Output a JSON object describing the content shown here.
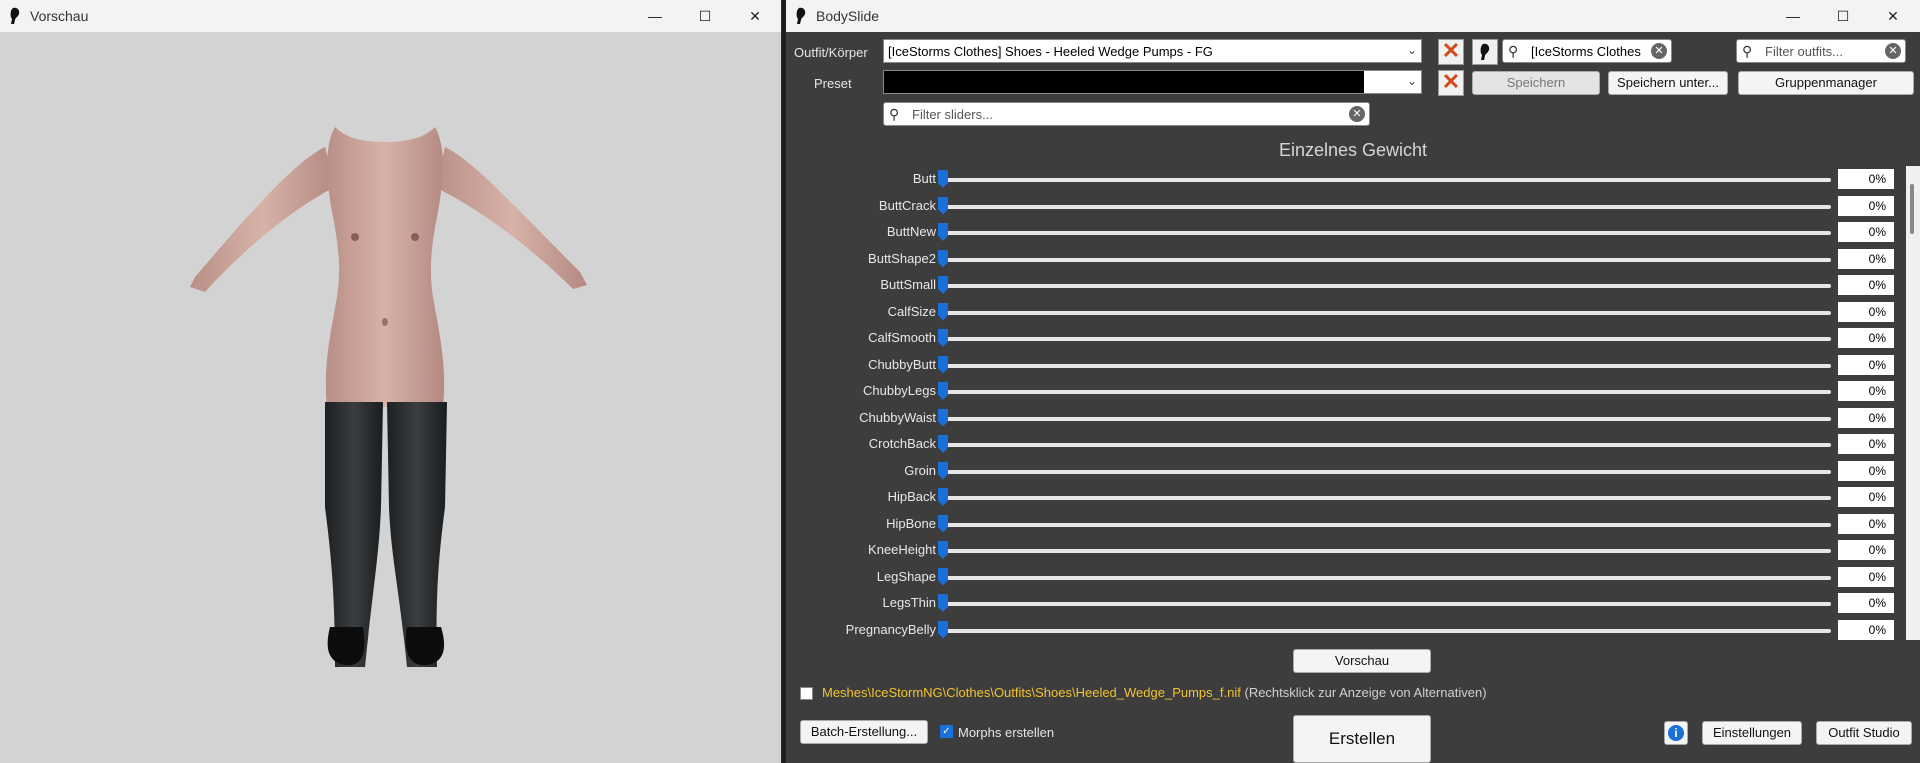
{
  "preview_window": {
    "title": "Vorschau",
    "controls": {
      "minimize": "—",
      "maximize": "☐",
      "close": "✕"
    }
  },
  "main_window": {
    "title": "BodySlide",
    "controls": {
      "minimize": "—",
      "maximize": "☐",
      "close": "✕"
    },
    "outfit_label": "Outfit/Körper",
    "outfit_value": "[IceStorms Clothes] Shoes - Heeled Wedge Pumps - FG",
    "outfit_search_value": "[IceStorms Clothes] S",
    "filter_outfits_placeholder": "Filter outfits...",
    "preset_label": "Preset",
    "preset_value": "",
    "save_button": "Speichern",
    "save_as_button": "Speichern unter...",
    "group_manager_button": "Gruppenmanager",
    "filter_sliders_placeholder": "Filter sliders...",
    "section_heading": "Einzelnes Gewicht",
    "sliders": [
      {
        "name": "Butt",
        "value": "0%",
        "level": 0
      },
      {
        "name": "ButtCrack",
        "value": "0%",
        "level": 0
      },
      {
        "name": "ButtNew",
        "value": "0%",
        "level": 0
      },
      {
        "name": "ButtShape2",
        "value": "0%",
        "level": 0
      },
      {
        "name": "ButtSmall",
        "value": "0%",
        "level": 0
      },
      {
        "name": "CalfSize",
        "value": "0%",
        "level": 0
      },
      {
        "name": "CalfSmooth",
        "value": "0%",
        "level": 0
      },
      {
        "name": "ChubbyButt",
        "value": "0%",
        "level": 0
      },
      {
        "name": "ChubbyLegs",
        "value": "0%",
        "level": 0
      },
      {
        "name": "ChubbyWaist",
        "value": "0%",
        "level": 0
      },
      {
        "name": "CrotchBack",
        "value": "0%",
        "level": 0
      },
      {
        "name": "Groin",
        "value": "0%",
        "level": 0
      },
      {
        "name": "HipBack",
        "value": "0%",
        "level": 0
      },
      {
        "name": "HipBone",
        "value": "0%",
        "level": 0
      },
      {
        "name": "KneeHeight",
        "value": "0%",
        "level": 0
      },
      {
        "name": "LegShape",
        "value": "0%",
        "level": 0
      },
      {
        "name": "LegsThin",
        "value": "0%",
        "level": 0
      },
      {
        "name": "PregnancyBelly",
        "value": "0%",
        "level": 0
      }
    ],
    "preview_button": "Vorschau",
    "file_path": "Meshes\\IceStormNG\\Clothes\\Outfits\\Shoes\\Heeled_Wedge_Pumps_f.nif",
    "file_path_hint": "(Rechtsklick zur Anzeige von Alternativen)",
    "batch_button": "Batch-Erstellung...",
    "morphs_label": "Morphs erstellen",
    "morphs_checked": true,
    "build_button": "Erstellen",
    "info_icon_glyph": "i",
    "settings_button": "Einstellungen",
    "outfit_studio_button": "Outfit Studio"
  }
}
